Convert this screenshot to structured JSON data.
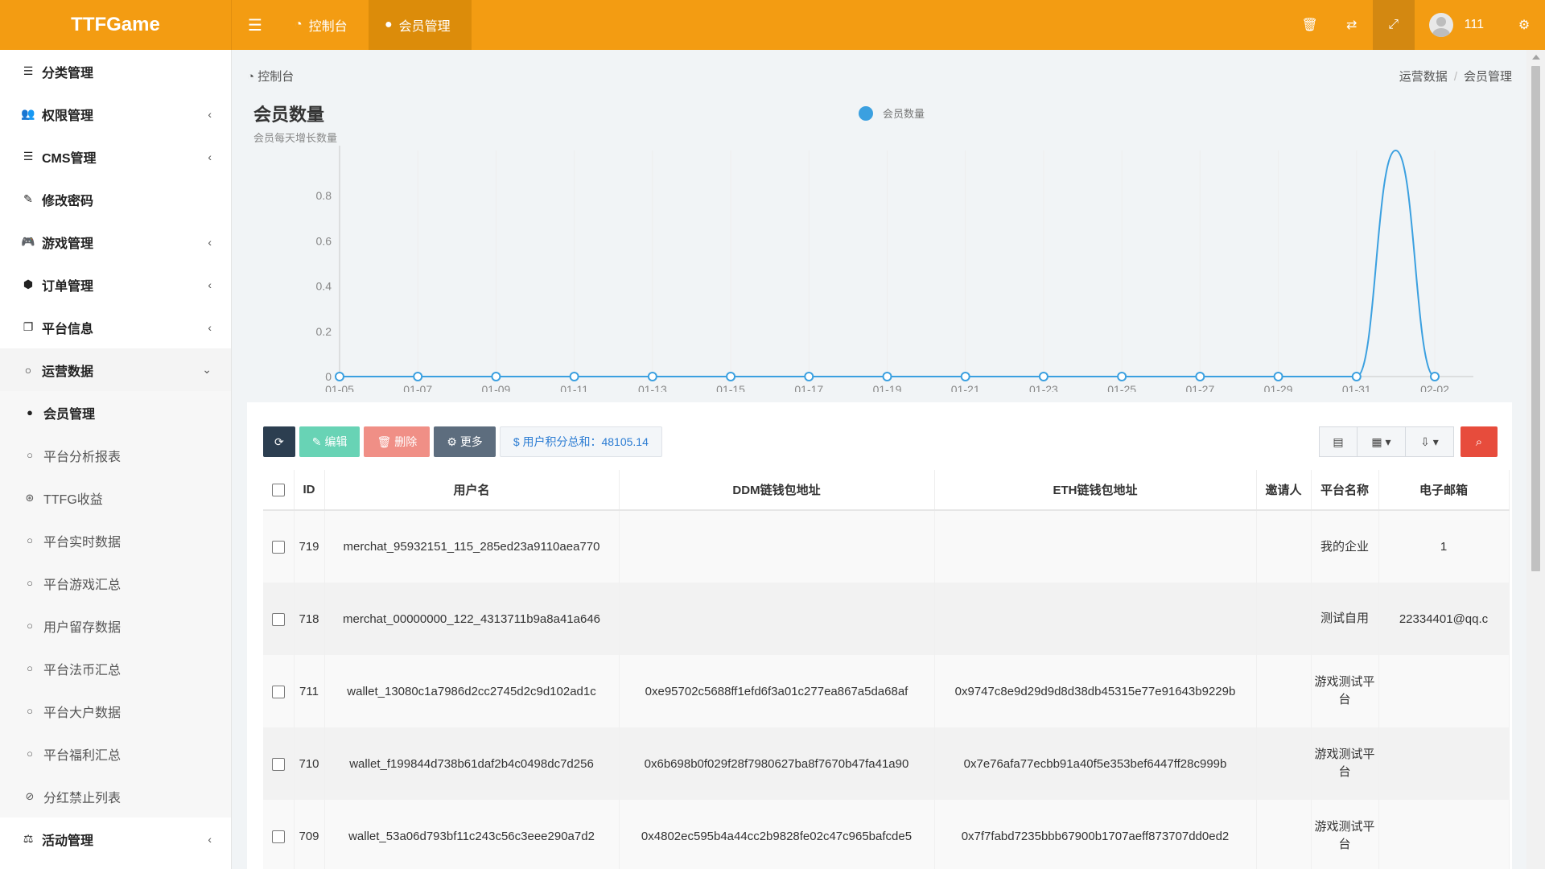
{
  "app": {
    "title": "TTFGame"
  },
  "topbar": {
    "tabs": [
      {
        "label": "控制台",
        "icon": "dashboard-icon"
      },
      {
        "label": "会员管理",
        "icon": "user-icon"
      }
    ],
    "user_name": "111"
  },
  "sidebar": {
    "items": [
      {
        "label": "分类管理",
        "icon": "list-icon",
        "expandable": false
      },
      {
        "label": "权限管理",
        "icon": "users-icon",
        "expandable": true
      },
      {
        "label": "CMS管理",
        "icon": "list-icon",
        "expandable": true
      },
      {
        "label": "修改密码",
        "icon": "brush-icon",
        "expandable": false
      },
      {
        "label": "游戏管理",
        "icon": "gamepad-icon",
        "expandable": true
      },
      {
        "label": "订单管理",
        "icon": "cube-icon",
        "expandable": true
      },
      {
        "label": "平台信息",
        "icon": "copy-icon",
        "expandable": true
      },
      {
        "label": "运营数据",
        "icon": "circle-icon",
        "expandable": true,
        "open": true
      }
    ],
    "sub_items": [
      {
        "label": "会员管理",
        "icon": "user-icon",
        "active": true
      },
      {
        "label": "平台分析报表",
        "icon": "circle-icon"
      },
      {
        "label": "TTFG收益",
        "icon": "life-ring-icon"
      },
      {
        "label": "平台实时数据",
        "icon": "circle-icon"
      },
      {
        "label": "平台游戏汇总",
        "icon": "circle-icon"
      },
      {
        "label": "用户留存数据",
        "icon": "circle-icon"
      },
      {
        "label": "平台法币汇总",
        "icon": "circle-icon"
      },
      {
        "label": "平台大户数据",
        "icon": "circle-icon"
      },
      {
        "label": "平台福利汇总",
        "icon": "circle-icon"
      },
      {
        "label": "分红禁止列表",
        "icon": "ban-icon"
      }
    ],
    "bottom_item": {
      "label": "活动管理",
      "icon": "balance-icon",
      "expandable": true
    }
  },
  "breadcrumb": {
    "left": "控制台",
    "right": [
      "运营数据",
      "会员管理"
    ]
  },
  "chart_data": {
    "type": "line",
    "title": "会员数量",
    "subtitle": "会员每天增长数量",
    "series": [
      {
        "name": "会员数量",
        "color": "#3ba0e0",
        "x": [
          "01-05",
          "01-06",
          "01-07",
          "01-08",
          "01-09",
          "01-10",
          "01-11",
          "01-12",
          "01-13",
          "01-14",
          "01-15",
          "01-16",
          "01-17",
          "01-18",
          "01-19",
          "01-20",
          "01-21",
          "01-22",
          "01-23",
          "01-24",
          "01-25",
          "01-26",
          "01-27",
          "01-28",
          "01-29",
          "01-30",
          "01-31",
          "02-01",
          "02-02"
        ],
        "values": [
          0,
          0,
          0,
          0,
          0,
          0,
          0,
          0,
          0,
          0,
          0,
          0,
          0,
          0,
          0,
          0,
          0,
          0,
          0,
          0,
          0,
          0,
          0,
          0,
          0,
          0,
          0,
          1,
          0
        ]
      }
    ],
    "x_tick_labels": [
      "01-05",
      "01-07",
      "01-09",
      "01-11",
      "01-13",
      "01-15",
      "01-17",
      "01-19",
      "01-21",
      "01-23",
      "01-25",
      "01-27",
      "01-29",
      "01-31",
      "02-02"
    ],
    "y_tick_labels": [
      "0",
      "0.2",
      "0.4",
      "0.6",
      "0.8",
      "1"
    ],
    "ylim": [
      0,
      1
    ],
    "grid": true,
    "legend": "top-center"
  },
  "toolbar": {
    "edit": "编辑",
    "delete": "删除",
    "more": "更多",
    "sum": "$ 用户积分总和：48105.14"
  },
  "table": {
    "headers": [
      "ID",
      "用户名",
      "DDM链钱包地址",
      "ETH链钱包地址",
      "邀请人",
      "平台名称",
      "电子邮箱"
    ],
    "rows": [
      {
        "id": "719",
        "username": "merchat_95932151_115_285ed23a9110aea770",
        "ddm": "",
        "eth": "",
        "inviter": "",
        "platform": "我的企业",
        "email": "1"
      },
      {
        "id": "718",
        "username": "merchat_00000000_122_4313711b9a8a41a646",
        "ddm": "",
        "eth": "",
        "inviter": "",
        "platform": "测试自用",
        "email": "22334401@qq.c"
      },
      {
        "id": "711",
        "username": "wallet_13080c1a7986d2cc2745d2c9d102ad1c",
        "ddm": "0xe95702c5688ff1efd6f3a01c277ea867a5da68af",
        "eth": "0x9747c8e9d29d9d8d38db45315e77e91643b9229b",
        "inviter": "",
        "platform": "游戏测试平台",
        "email": ""
      },
      {
        "id": "710",
        "username": "wallet_f199844d738b61daf2b4c0498dc7d256",
        "ddm": "0x6b698b0f029f28f7980627ba8f7670b47fa41a90",
        "eth": "0x7e76afa77ecbb91a40f5e353bef6447ff28c999b",
        "inviter": "",
        "platform": "游戏测试平台",
        "email": ""
      },
      {
        "id": "709",
        "username": "wallet_53a06d793bf11c243c56c3eee290a7d2",
        "ddm": "0x4802ec595b4a44cc2b9828fe02c47c965bafcde5",
        "eth": "0x7f7fabd7235bbb67900b1707aeff873707dd0ed2",
        "inviter": "",
        "platform": "游戏测试平台",
        "email": ""
      }
    ]
  }
}
